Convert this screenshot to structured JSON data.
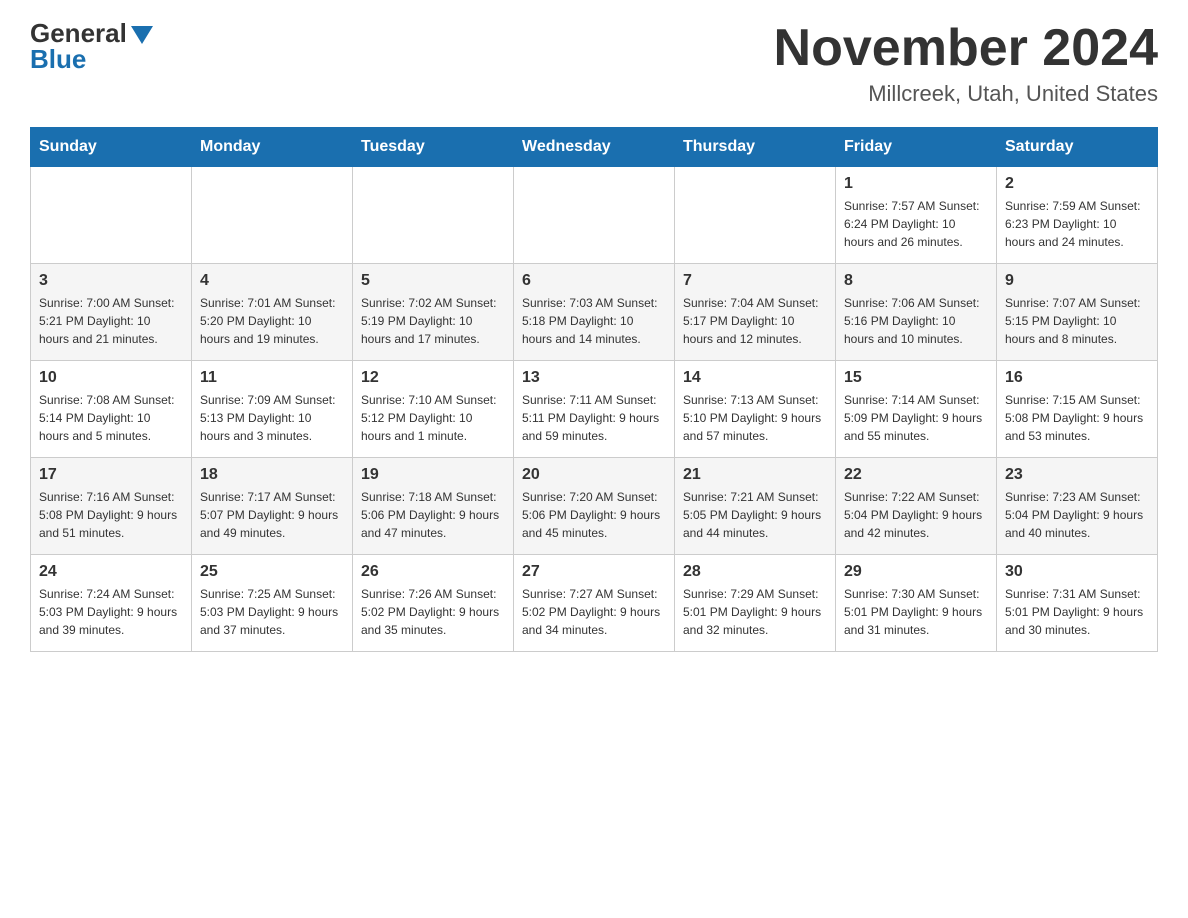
{
  "header": {
    "logo_general": "General",
    "logo_blue": "Blue",
    "month_title": "November 2024",
    "location": "Millcreek, Utah, United States"
  },
  "calendar": {
    "days_of_week": [
      "Sunday",
      "Monday",
      "Tuesday",
      "Wednesday",
      "Thursday",
      "Friday",
      "Saturday"
    ],
    "weeks": [
      [
        {
          "day": "",
          "info": ""
        },
        {
          "day": "",
          "info": ""
        },
        {
          "day": "",
          "info": ""
        },
        {
          "day": "",
          "info": ""
        },
        {
          "day": "",
          "info": ""
        },
        {
          "day": "1",
          "info": "Sunrise: 7:57 AM\nSunset: 6:24 PM\nDaylight: 10 hours and 26 minutes."
        },
        {
          "day": "2",
          "info": "Sunrise: 7:59 AM\nSunset: 6:23 PM\nDaylight: 10 hours and 24 minutes."
        }
      ],
      [
        {
          "day": "3",
          "info": "Sunrise: 7:00 AM\nSunset: 5:21 PM\nDaylight: 10 hours and 21 minutes."
        },
        {
          "day": "4",
          "info": "Sunrise: 7:01 AM\nSunset: 5:20 PM\nDaylight: 10 hours and 19 minutes."
        },
        {
          "day": "5",
          "info": "Sunrise: 7:02 AM\nSunset: 5:19 PM\nDaylight: 10 hours and 17 minutes."
        },
        {
          "day": "6",
          "info": "Sunrise: 7:03 AM\nSunset: 5:18 PM\nDaylight: 10 hours and 14 minutes."
        },
        {
          "day": "7",
          "info": "Sunrise: 7:04 AM\nSunset: 5:17 PM\nDaylight: 10 hours and 12 minutes."
        },
        {
          "day": "8",
          "info": "Sunrise: 7:06 AM\nSunset: 5:16 PM\nDaylight: 10 hours and 10 minutes."
        },
        {
          "day": "9",
          "info": "Sunrise: 7:07 AM\nSunset: 5:15 PM\nDaylight: 10 hours and 8 minutes."
        }
      ],
      [
        {
          "day": "10",
          "info": "Sunrise: 7:08 AM\nSunset: 5:14 PM\nDaylight: 10 hours and 5 minutes."
        },
        {
          "day": "11",
          "info": "Sunrise: 7:09 AM\nSunset: 5:13 PM\nDaylight: 10 hours and 3 minutes."
        },
        {
          "day": "12",
          "info": "Sunrise: 7:10 AM\nSunset: 5:12 PM\nDaylight: 10 hours and 1 minute."
        },
        {
          "day": "13",
          "info": "Sunrise: 7:11 AM\nSunset: 5:11 PM\nDaylight: 9 hours and 59 minutes."
        },
        {
          "day": "14",
          "info": "Sunrise: 7:13 AM\nSunset: 5:10 PM\nDaylight: 9 hours and 57 minutes."
        },
        {
          "day": "15",
          "info": "Sunrise: 7:14 AM\nSunset: 5:09 PM\nDaylight: 9 hours and 55 minutes."
        },
        {
          "day": "16",
          "info": "Sunrise: 7:15 AM\nSunset: 5:08 PM\nDaylight: 9 hours and 53 minutes."
        }
      ],
      [
        {
          "day": "17",
          "info": "Sunrise: 7:16 AM\nSunset: 5:08 PM\nDaylight: 9 hours and 51 minutes."
        },
        {
          "day": "18",
          "info": "Sunrise: 7:17 AM\nSunset: 5:07 PM\nDaylight: 9 hours and 49 minutes."
        },
        {
          "day": "19",
          "info": "Sunrise: 7:18 AM\nSunset: 5:06 PM\nDaylight: 9 hours and 47 minutes."
        },
        {
          "day": "20",
          "info": "Sunrise: 7:20 AM\nSunset: 5:06 PM\nDaylight: 9 hours and 45 minutes."
        },
        {
          "day": "21",
          "info": "Sunrise: 7:21 AM\nSunset: 5:05 PM\nDaylight: 9 hours and 44 minutes."
        },
        {
          "day": "22",
          "info": "Sunrise: 7:22 AM\nSunset: 5:04 PM\nDaylight: 9 hours and 42 minutes."
        },
        {
          "day": "23",
          "info": "Sunrise: 7:23 AM\nSunset: 5:04 PM\nDaylight: 9 hours and 40 minutes."
        }
      ],
      [
        {
          "day": "24",
          "info": "Sunrise: 7:24 AM\nSunset: 5:03 PM\nDaylight: 9 hours and 39 minutes."
        },
        {
          "day": "25",
          "info": "Sunrise: 7:25 AM\nSunset: 5:03 PM\nDaylight: 9 hours and 37 minutes."
        },
        {
          "day": "26",
          "info": "Sunrise: 7:26 AM\nSunset: 5:02 PM\nDaylight: 9 hours and 35 minutes."
        },
        {
          "day": "27",
          "info": "Sunrise: 7:27 AM\nSunset: 5:02 PM\nDaylight: 9 hours and 34 minutes."
        },
        {
          "day": "28",
          "info": "Sunrise: 7:29 AM\nSunset: 5:01 PM\nDaylight: 9 hours and 32 minutes."
        },
        {
          "day": "29",
          "info": "Sunrise: 7:30 AM\nSunset: 5:01 PM\nDaylight: 9 hours and 31 minutes."
        },
        {
          "day": "30",
          "info": "Sunrise: 7:31 AM\nSunset: 5:01 PM\nDaylight: 9 hours and 30 minutes."
        }
      ]
    ]
  }
}
